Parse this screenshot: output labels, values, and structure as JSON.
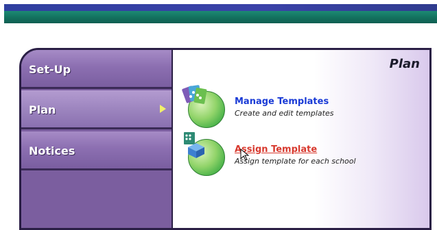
{
  "nav": {
    "items": [
      {
        "label": "Set-Up"
      },
      {
        "label": "Plan",
        "active": true
      },
      {
        "label": "Notices"
      }
    ]
  },
  "content": {
    "title": "Plan",
    "actions": [
      {
        "icon": "templates-icon",
        "title": "Manage Templates",
        "description": "Create and edit templates"
      },
      {
        "icon": "assign-template-icon",
        "title": "Assign Template",
        "description": "Assign template for each school"
      }
    ]
  },
  "colors": {
    "banner_blue": "#3a42a8",
    "banner_green": "#13705e",
    "sidebar": "#8c6fb1",
    "link": "#1a3bd6",
    "link_hover": "#d83a2f",
    "active_arrow": "#f1f16a"
  }
}
